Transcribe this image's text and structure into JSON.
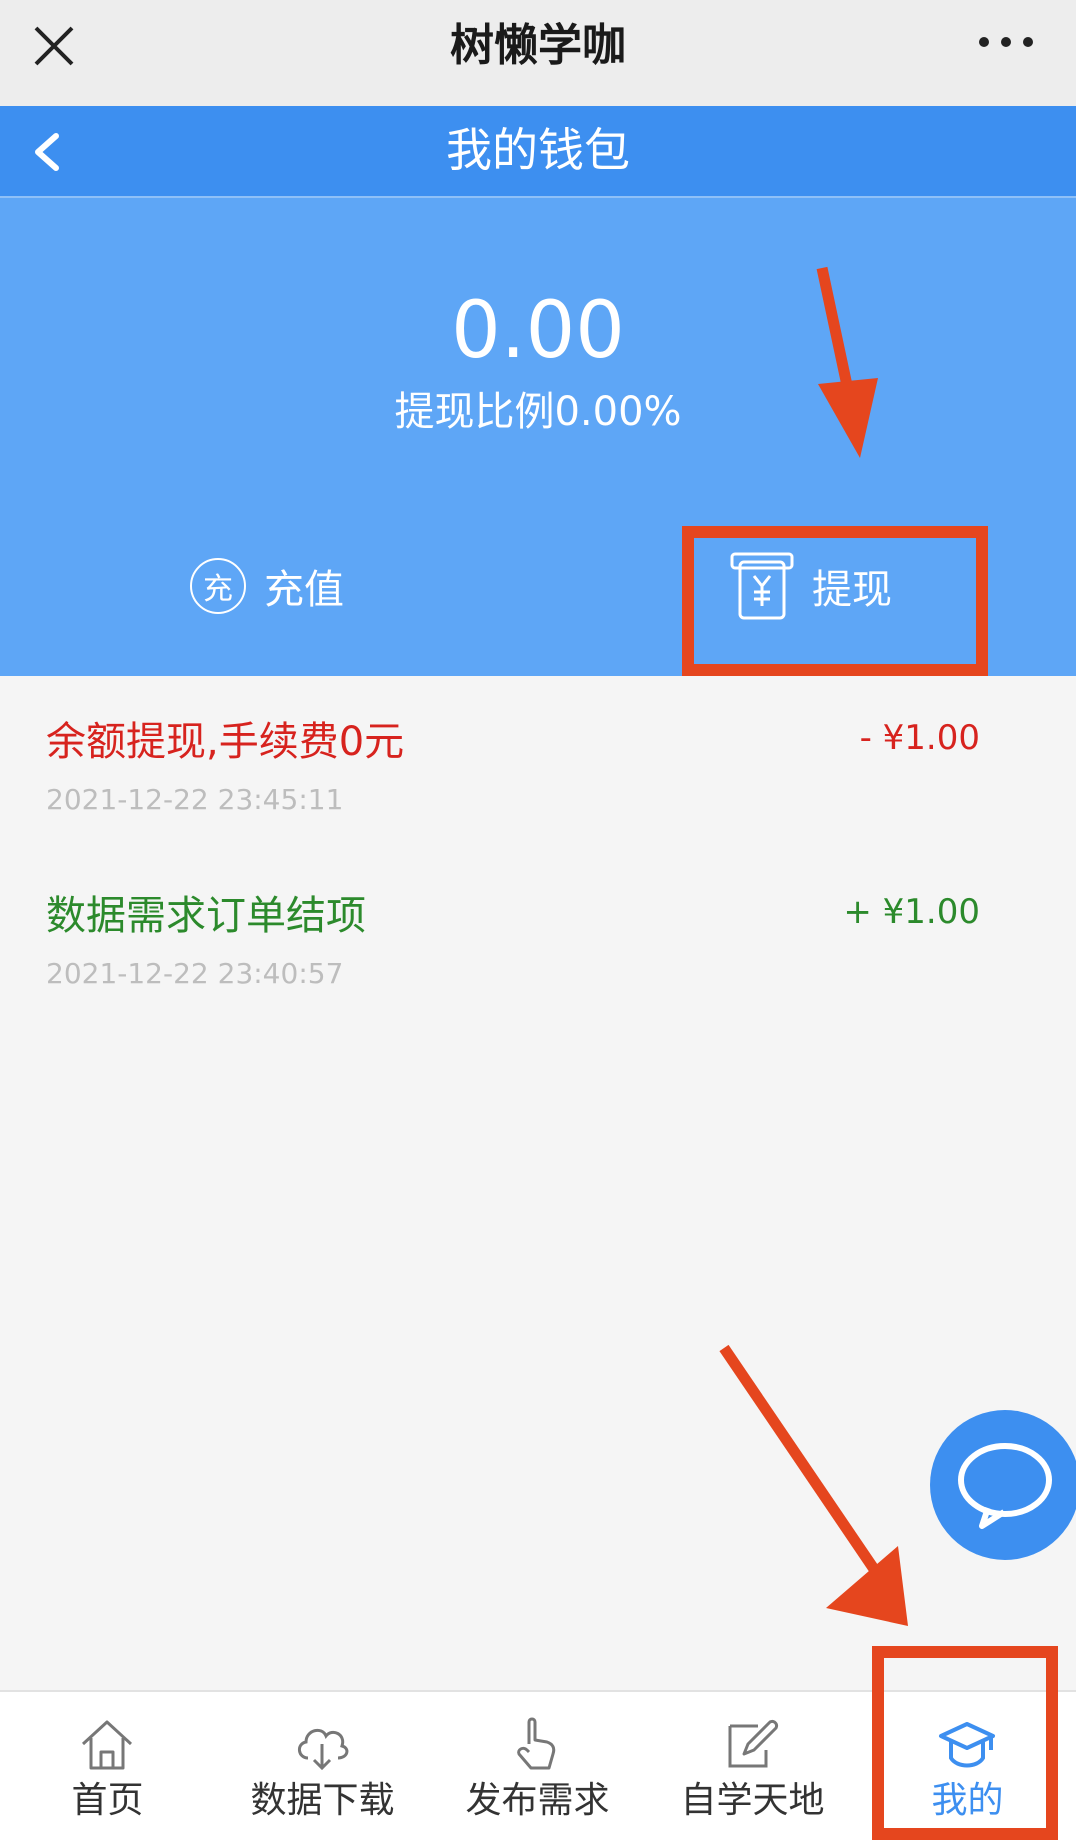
{
  "window": {
    "title": "树懒学咖"
  },
  "page": {
    "title": "我的钱包"
  },
  "wallet": {
    "balance": "0.00",
    "ratio": "提现比例0.00%",
    "recharge_icon_text": "充",
    "recharge_label": "充值",
    "withdraw_label": "提现"
  },
  "transactions": [
    {
      "desc": "余额提现,手续费0元",
      "amount": "- ¥1.00",
      "time": "2021-12-22 23:45:11",
      "color": "#d7231e"
    },
    {
      "desc": "数据需求订单结项",
      "amount": "+ ¥1.00",
      "time": "2021-12-22 23:40:57",
      "color": "#2c8a2c"
    }
  ],
  "tabs": [
    {
      "label": "首页",
      "icon": "home-icon"
    },
    {
      "label": "数据下载",
      "icon": "cloud-download-icon"
    },
    {
      "label": "发布需求",
      "icon": "hand-touch-icon"
    },
    {
      "label": "自学天地",
      "icon": "pen-paper-icon"
    },
    {
      "label": "我的",
      "icon": "graduation-cap-icon",
      "active": true
    }
  ],
  "colors": {
    "nav_blue": "#3d8ff0",
    "hero_blue": "#5ea6f6",
    "annotation_red": "#e5461e"
  }
}
